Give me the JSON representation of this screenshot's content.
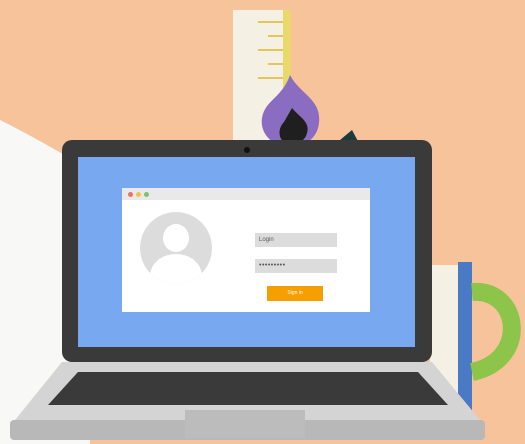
{
  "colors": {
    "background": "#f6c39a",
    "screen": "#78a8f0",
    "laptop_frame": "#3a3a3a",
    "keyboard_deck": "#c9c9c9",
    "button": "#f5a000",
    "flame": "#8a6cc0",
    "mug_handle": "#8dc44a"
  },
  "login_form": {
    "login_placeholder": "Login",
    "password_value": "•••••••••",
    "signin_label": "Sign in"
  },
  "window_dots": [
    "#e8716a",
    "#f2c14e",
    "#79c46b"
  ]
}
